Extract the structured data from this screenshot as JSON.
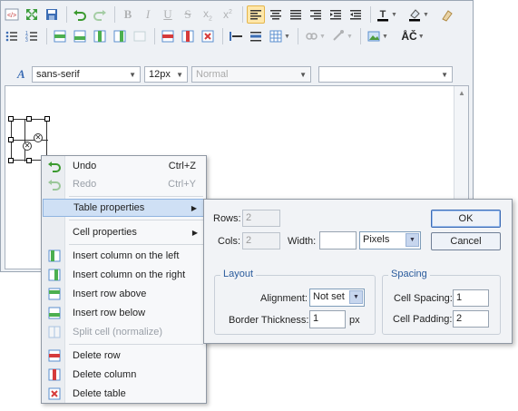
{
  "toolbar": {
    "font_family": "sans-serif",
    "font_size": "12px",
    "format_block": "Normal",
    "style_combo": ""
  },
  "context_menu": {
    "items": [
      {
        "label": "Undo",
        "shortcut": "Ctrl+Z",
        "icon": "undo-icon",
        "disabled": false
      },
      {
        "label": "Redo",
        "shortcut": "Ctrl+Y",
        "icon": "redo-icon",
        "disabled": true
      },
      {
        "label": "Table properties",
        "submenu": true,
        "hover": true
      },
      {
        "label": "Cell properties",
        "submenu": true
      },
      {
        "label": "Insert column on the left",
        "icon": "insert-column-left-icon"
      },
      {
        "label": "Insert column on the right",
        "icon": "insert-column-right-icon"
      },
      {
        "label": "Insert row above",
        "icon": "insert-row-above-icon"
      },
      {
        "label": "Insert row below",
        "icon": "insert-row-below-icon"
      },
      {
        "label": "Split cell (normalize)",
        "icon": "split-cell-icon",
        "disabled": true
      },
      {
        "label": "Delete row",
        "icon": "delete-row-icon"
      },
      {
        "label": "Delete column",
        "icon": "delete-column-icon"
      },
      {
        "label": "Delete table",
        "icon": "delete-table-icon"
      }
    ]
  },
  "dialog": {
    "rows_label": "Rows:",
    "rows_value": "2",
    "cols_label": "Cols:",
    "cols_value": "2",
    "width_label": "Width:",
    "width_value": "",
    "width_unit": "Pixels",
    "ok_label": "OK",
    "cancel_label": "Cancel",
    "layout_title": "Layout",
    "alignment_label": "Alignment:",
    "alignment_value": "Not set",
    "border_label": "Border Thickness:",
    "border_value": "1",
    "border_unit": "px",
    "spacing_title": "Spacing",
    "cell_spacing_label": "Cell Spacing:",
    "cell_spacing_value": "1",
    "cell_padding_label": "Cell Padding:",
    "cell_padding_value": "2"
  }
}
